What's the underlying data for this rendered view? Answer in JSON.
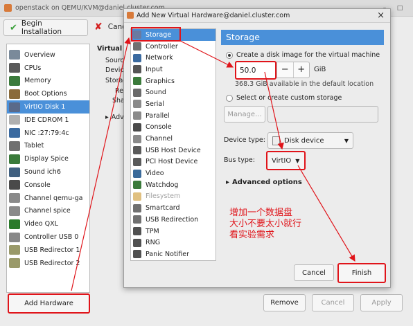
{
  "main_window": {
    "title": "openstack on QEMU/KVM@daniel.cluster.com",
    "toolbar": {
      "begin_installation": "Begin Installation",
      "cancel": "Canc"
    },
    "hardware": [
      {
        "label": "Overview",
        "icon": "overview-icon"
      },
      {
        "label": "CPUs",
        "icon": "cpu-icon"
      },
      {
        "label": "Memory",
        "icon": "memory-icon"
      },
      {
        "label": "Boot Options",
        "icon": "boot-options-icon"
      },
      {
        "label": "VirtIO Disk 1",
        "icon": "disk-icon",
        "selected": true
      },
      {
        "label": "IDE CDROM 1",
        "icon": "cdrom-icon"
      },
      {
        "label": "NIC :27:79:4c",
        "icon": "nic-icon"
      },
      {
        "label": "Tablet",
        "icon": "tablet-icon"
      },
      {
        "label": "Display Spice",
        "icon": "display-icon"
      },
      {
        "label": "Sound ich6",
        "icon": "sound-icon"
      },
      {
        "label": "Console",
        "icon": "console-icon"
      },
      {
        "label": "Channel qemu-ga",
        "icon": "channel-icon"
      },
      {
        "label": "Channel spice",
        "icon": "channel-icon"
      },
      {
        "label": "Video QXL",
        "icon": "video-icon"
      },
      {
        "label": "Controller USB 0",
        "icon": "controller-icon"
      },
      {
        "label": "USB Redirector 1",
        "icon": "usb-redirector-icon"
      },
      {
        "label": "USB Redirector 2",
        "icon": "usb-redirector-icon"
      }
    ],
    "detail_partial": [
      "Virtual",
      "Sourc",
      "Devic",
      "Storag",
      "Re",
      "Sha",
      "Adv"
    ],
    "add_hardware": "Add Hardware",
    "remove": "Remove",
    "cancel": "Cancel",
    "apply": "Apply"
  },
  "dialog": {
    "title": "Add New Virtual Hardware@daniel.cluster.com",
    "close_glyph": "×",
    "devices": [
      {
        "label": "Storage",
        "icon": "storage-icon",
        "selected": true
      },
      {
        "label": "Controller",
        "icon": "controller-icon"
      },
      {
        "label": "Network",
        "icon": "network-icon"
      },
      {
        "label": "Input",
        "icon": "input-icon"
      },
      {
        "label": "Graphics",
        "icon": "graphics-icon"
      },
      {
        "label": "Sound",
        "icon": "sound-icon"
      },
      {
        "label": "Serial",
        "icon": "serial-icon"
      },
      {
        "label": "Parallel",
        "icon": "parallel-icon"
      },
      {
        "label": "Console",
        "icon": "console-icon"
      },
      {
        "label": "Channel",
        "icon": "channel-icon"
      },
      {
        "label": "USB Host Device",
        "icon": "usb-host-icon"
      },
      {
        "label": "PCI Host Device",
        "icon": "pci-host-icon"
      },
      {
        "label": "Video",
        "icon": "video-icon"
      },
      {
        "label": "Watchdog",
        "icon": "watchdog-icon"
      },
      {
        "label": "Filesystem",
        "icon": "filesystem-icon",
        "disabled": true
      },
      {
        "label": "Smartcard",
        "icon": "smartcard-icon"
      },
      {
        "label": "USB Redirection",
        "icon": "usb-redirection-icon"
      },
      {
        "label": "TPM",
        "icon": "tpm-icon"
      },
      {
        "label": "RNG",
        "icon": "rng-icon"
      },
      {
        "label": "Panic Notifier",
        "icon": "panic-notifier-icon"
      }
    ],
    "panel_title": "Storage",
    "create_disk_label": "Create a disk image for the virtual machine",
    "disk_size": "50.0",
    "minus": "−",
    "plus": "+",
    "unit": "GiB",
    "available": "368.3 GiB available in the default location",
    "custom_storage_label": "Select or create custom storage",
    "manage": "Manage...",
    "device_type_label": "Device type:",
    "device_type_value": "Disk device",
    "bus_type_label": "Bus type:",
    "bus_type_value": "VirtIO",
    "advanced": "Advanced options",
    "cancel": "Cancel",
    "finish": "Finish"
  },
  "annotation": {
    "line1": "增加一个数据盘",
    "line2": "大小不要太小就行",
    "line3": "看实验需求",
    "color": "#e0141a"
  },
  "colors": {
    "selection": "#4a90d9",
    "highlight": "#e0141a"
  }
}
